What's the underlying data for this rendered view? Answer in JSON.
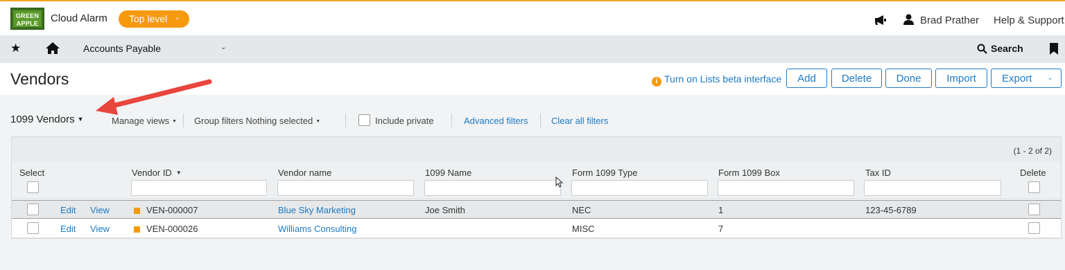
{
  "header": {
    "logo_line1": "GREEN",
    "logo_line2": "APPLE",
    "app_name": "Cloud Alarm",
    "level_label": "Top level",
    "user_name": "Brad Prather",
    "help_label": "Help & Support"
  },
  "nav": {
    "module": "Accounts Payable",
    "search_label": "Search"
  },
  "page": {
    "title": "Vendors",
    "beta_link": "Turn on Lists beta interface",
    "buttons": {
      "add": "Add",
      "delete": "Delete",
      "done": "Done",
      "import": "Import",
      "export": "Export"
    }
  },
  "filters": {
    "view_name": "1099 Vendors",
    "manage_views": "Manage views",
    "group_filters": "Group filters Nothing selected",
    "include_private": "Include private",
    "advanced_filters": "Advanced filters",
    "clear_filters": "Clear all filters"
  },
  "grid": {
    "count": "(1 - 2 of 2)",
    "columns": {
      "select": "Select",
      "vendor_id": "Vendor ID",
      "vendor_name": "Vendor name",
      "name_1099": "1099 Name",
      "form_type": "Form 1099 Type",
      "form_box": "Form 1099 Box",
      "tax_id": "Tax ID",
      "delete": "Delete"
    },
    "rows": [
      {
        "edit": "Edit",
        "view": "View",
        "vendor_id": "VEN-000007",
        "vendor_name": "Blue Sky Marketing",
        "name_1099": "Joe Smith",
        "form_type": "NEC",
        "form_box": "1",
        "tax_id": "123-45-6789"
      },
      {
        "edit": "Edit",
        "view": "View",
        "vendor_id": "VEN-000026",
        "vendor_name": "Williams Consulting",
        "name_1099": "",
        "form_type": "MISC",
        "form_box": "7",
        "tax_id": ""
      }
    ]
  },
  "colors": {
    "accent": "#f59a0f",
    "link": "#1d7ac4",
    "annotation_arrow": "#e8463c"
  }
}
